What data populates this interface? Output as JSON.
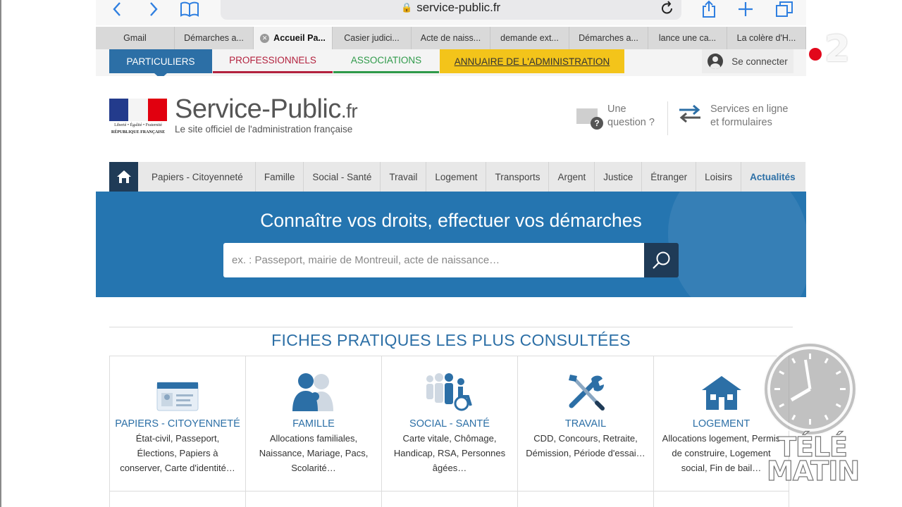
{
  "browser": {
    "url": "service-public.fr",
    "icons": [
      "back-icon",
      "forward-icon",
      "bookmarks-icon",
      "lock-icon",
      "reload-icon",
      "share-icon",
      "new-tab-icon",
      "tabs-icon"
    ],
    "tabs": [
      {
        "label": "Gmail"
      },
      {
        "label": "Démarches a..."
      },
      {
        "label": "Accueil Pa..."
      },
      {
        "label": "Casier judici..."
      },
      {
        "label": "Acte de naiss..."
      },
      {
        "label": "demande ext..."
      },
      {
        "label": "Démarches a..."
      },
      {
        "label": "lance une ca..."
      },
      {
        "label": "La colère d'H..."
      }
    ]
  },
  "category_nav": {
    "particuliers": "PARTICULIERS",
    "professionnels": "PROFESSIONNELS",
    "associations": "ASSOCIATIONS",
    "annuaire": "ANNUAIRE DE L'ADMINISTRATION",
    "login": "Se connecter"
  },
  "header": {
    "logo_caption": "Liberté • Égalité • Fraternité",
    "logo_caption2": "RÉPUBLIQUE FRANÇAISE",
    "brand": "Service-Public",
    "brand_tld": ".fr",
    "tagline": "Le site officiel de l'administration française",
    "question_line1": "Une",
    "question_line2": "question ?",
    "services_line1": "Services en ligne",
    "services_line2": "et formulaires"
  },
  "main_nav": [
    "Papiers - Citoyenneté",
    "Famille",
    "Social - Santé",
    "Travail",
    "Logement",
    "Transports",
    "Argent",
    "Justice",
    "Étranger",
    "Loisirs",
    "Actualités"
  ],
  "hero": {
    "title": "Connaître vos droits, effectuer vos démarches",
    "search_placeholder": "ex. : Passeport, mairie de Montreuil, acte de naissance…"
  },
  "fiches": {
    "title": "FICHES PRATIQUES LES PLUS CONSULTÉES",
    "items": [
      {
        "title": "PAPIERS - CITOYENNETÉ",
        "desc": "État-civil, Passeport, Élections, Papiers à conserver, Carte d'identité…",
        "icon": "id-card-icon"
      },
      {
        "title": "FAMILLE",
        "desc": "Allocations familiales, Naissance, Mariage, Pacs, Scolarité…",
        "icon": "family-icon"
      },
      {
        "title": "SOCIAL - SANTÉ",
        "desc": "Carte vitale, Chômage, Handicap, RSA, Personnes âgées…",
        "icon": "people-wheelchair-icon"
      },
      {
        "title": "TRAVAIL",
        "desc": "CDD, Concours, Retraite, Démission, Période d'essai…",
        "icon": "tools-icon"
      },
      {
        "title": "LOGEMENT",
        "desc": "Allocations logement, Permis de construire, Logement social, Fin de bail…",
        "icon": "house-icon"
      }
    ]
  },
  "overlay": {
    "channel": "2",
    "show_line1": "TÉLÉ",
    "show_line2": "MATIN"
  },
  "colors": {
    "primary_blue": "#2c6fa6",
    "hero_blue": "#2575b0",
    "dark_navy": "#1f3b57",
    "pro_red": "#b3223e",
    "asso_green": "#2f9a4a",
    "annuaire_yellow": "#f3c41a",
    "safari_blue": "#2f7fe0"
  }
}
